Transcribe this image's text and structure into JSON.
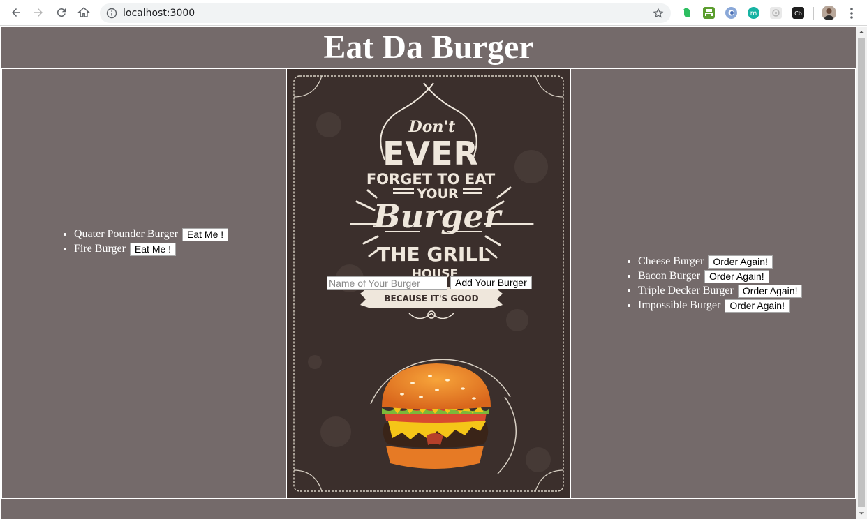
{
  "browser": {
    "url": "localhost:3000",
    "icons": [
      "back-icon",
      "forward-icon",
      "reload-icon",
      "home-icon",
      "info-icon",
      "star-icon",
      "evernote-icon",
      "print-icon",
      "extension-icon",
      "moment-icon",
      "settings-extension-icon",
      "cb-icon",
      "profile-avatar",
      "more-menu-icon"
    ]
  },
  "page": {
    "title": "Eat Da Burger"
  },
  "devoured": {
    "items": [
      {
        "name": "Quater Pounder Burger",
        "button": "Eat Me !"
      },
      {
        "name": "Fire Burger",
        "button": "Eat Me !"
      }
    ]
  },
  "form": {
    "placeholder": "Name of Your Burger",
    "submit_label": "Add Your Burger"
  },
  "eaten": {
    "items": [
      {
        "name": "Cheese Burger",
        "button": "Order Again!"
      },
      {
        "name": "Bacon Burger",
        "button": "Order Again!"
      },
      {
        "name": "Triple Decker Burger",
        "button": "Order Again!"
      },
      {
        "name": "Impossible Burger",
        "button": "Order Again!"
      }
    ]
  },
  "poster": {
    "line1": "Don't",
    "line2": "EVER",
    "line3": "FORGET TO EAT",
    "line4": "YOUR",
    "line5": "Burger",
    "line6": "THE GRILL",
    "line7": "HOUSE",
    "line8": "BECAUSE IT'S GOOD"
  },
  "colors": {
    "page_bg": "#746a6a",
    "poster_bg": "#3b2f2c",
    "poster_ink": "#efe7dc"
  }
}
